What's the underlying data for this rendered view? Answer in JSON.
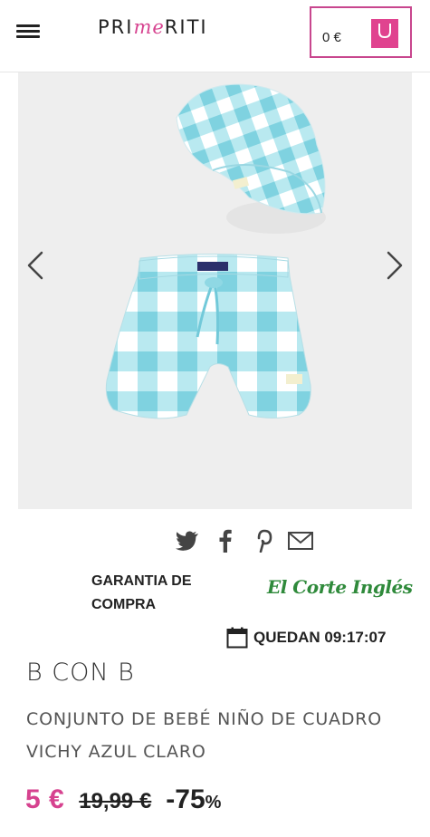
{
  "header": {
    "menu_icon": "hamburger-menu-icon",
    "logo": {
      "pre": "PRI",
      "mid": "me",
      "post": "RITI"
    },
    "cart": {
      "total": "0 €",
      "icon": "shopping-bag-icon",
      "accent": "#e0438f"
    }
  },
  "gallery": {
    "prev_icon": "chevron-left-icon",
    "next_icon": "chevron-right-icon",
    "background": "#eeeeee",
    "product_colors": [
      "#8fd8e4",
      "#ffffff"
    ]
  },
  "share": {
    "icons": [
      "twitter-icon",
      "facebook-icon",
      "pinterest-icon",
      "email-icon"
    ]
  },
  "guarantee": {
    "line1": "GARANTIA DE",
    "line2": "COMPRA",
    "store": "El Corte Inglés",
    "store_color": "#2f8a3b"
  },
  "countdown": {
    "icon": "calendar-icon",
    "text": "QUEDAN 09:17:07"
  },
  "product": {
    "brand": "B CON B",
    "description": "CONJUNTO DE BEBÉ NIÑO DE CUADRO VICHY AZUL CLARO",
    "price": "5 €",
    "old_price": "19,99 €",
    "discount": "-75",
    "discount_symbol": "%",
    "price_color": "#d6428f"
  }
}
